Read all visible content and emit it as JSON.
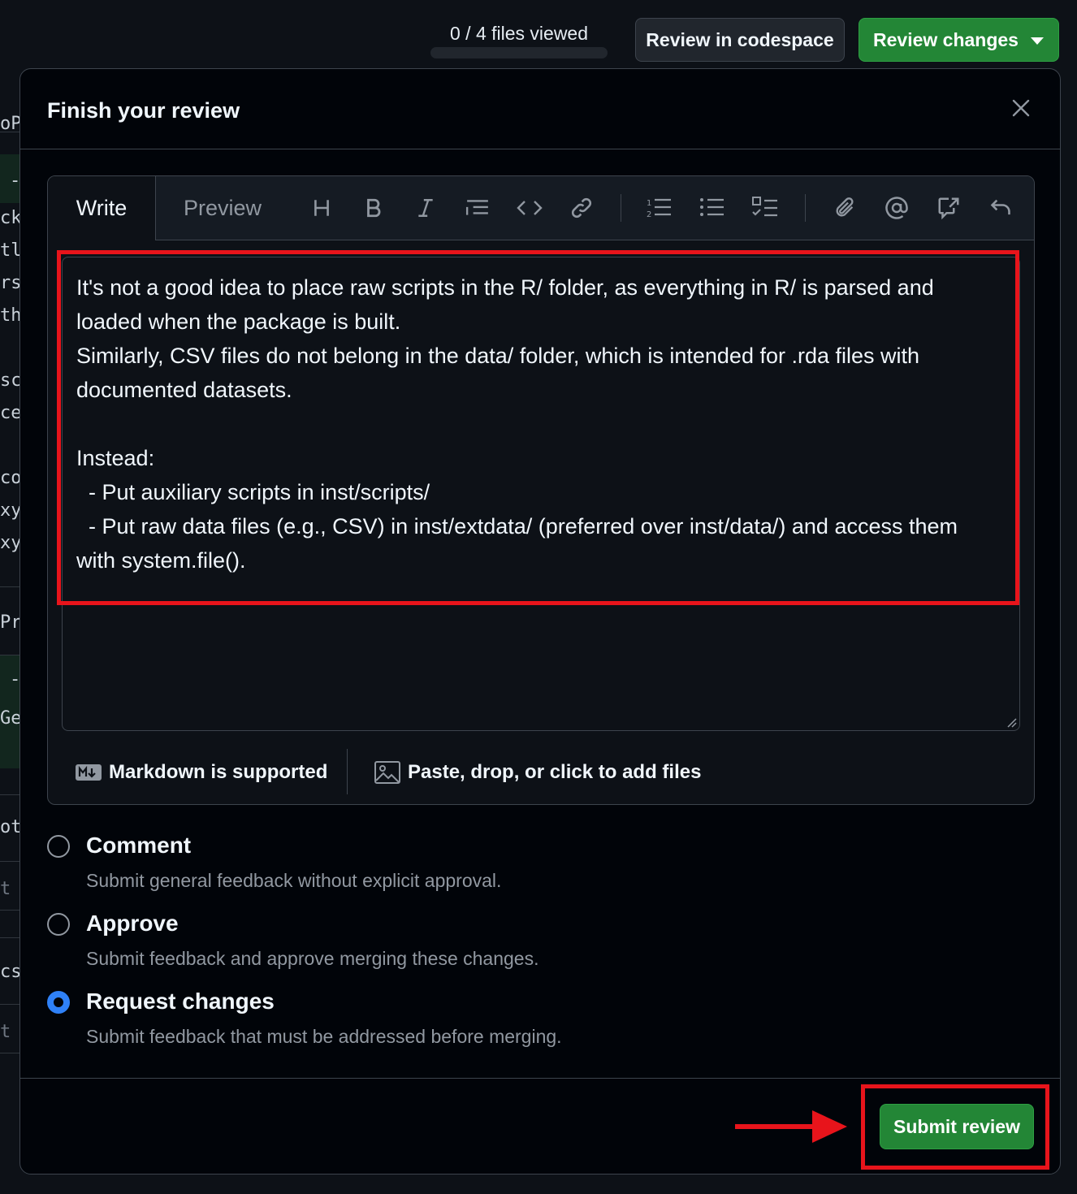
{
  "gutter": {
    "fragments": [
      "oPr",
      "-",
      "ck",
      "tl",
      "rs",
      "th",
      "sc",
      "ce",
      "co",
      "xy",
      "xy",
      "Pr",
      "-",
      "Ge",
      "ot",
      "t c",
      "cs",
      "t c"
    ]
  },
  "header": {
    "files_viewed": "0 / 4 files viewed",
    "files_viewed_fraction": 0,
    "codespace_label": "Review in codespace",
    "review_changes_label": "Review changes"
  },
  "dialog": {
    "title": "Finish your review",
    "tabs": {
      "write": "Write",
      "preview": "Preview"
    },
    "toolbar_icons": [
      "heading-icon",
      "bold-icon",
      "italic-icon",
      "quote-icon",
      "code-icon",
      "link-icon",
      "numbered-list-icon",
      "bullet-list-icon",
      "task-list-icon",
      "attach-icon",
      "mention-icon",
      "cross-reference-icon",
      "undo-icon"
    ],
    "comment_text": "It's not a good idea to place raw scripts in the R/ folder, as everything in R/ is parsed and loaded when the package is built.\nSimilarly, CSV files do not belong in the data/ folder, which is intended for .rda files with documented datasets.\n\nInstead:\n  - Put auxiliary scripts in inst/scripts/\n  - Put raw data files (e.g., CSV) in inst/extdata/ (preferred over inst/data/) and access them with system.file().",
    "markdown_label": "Markdown is supported",
    "attach_label": "Paste, drop, or click to add files",
    "options": [
      {
        "title": "Comment",
        "desc": "Submit general feedback without explicit approval.",
        "checked": false
      },
      {
        "title": "Approve",
        "desc": "Submit feedback and approve merging these changes.",
        "checked": false
      },
      {
        "title": "Request changes",
        "desc": "Submit feedback that must be addressed before merging.",
        "checked": true
      }
    ],
    "submit_label": "Submit review"
  },
  "colors": {
    "accent_green": "#238636",
    "radio_blue": "#2f81f7",
    "highlight_red": "#e8141b",
    "background": "#0d1117"
  }
}
